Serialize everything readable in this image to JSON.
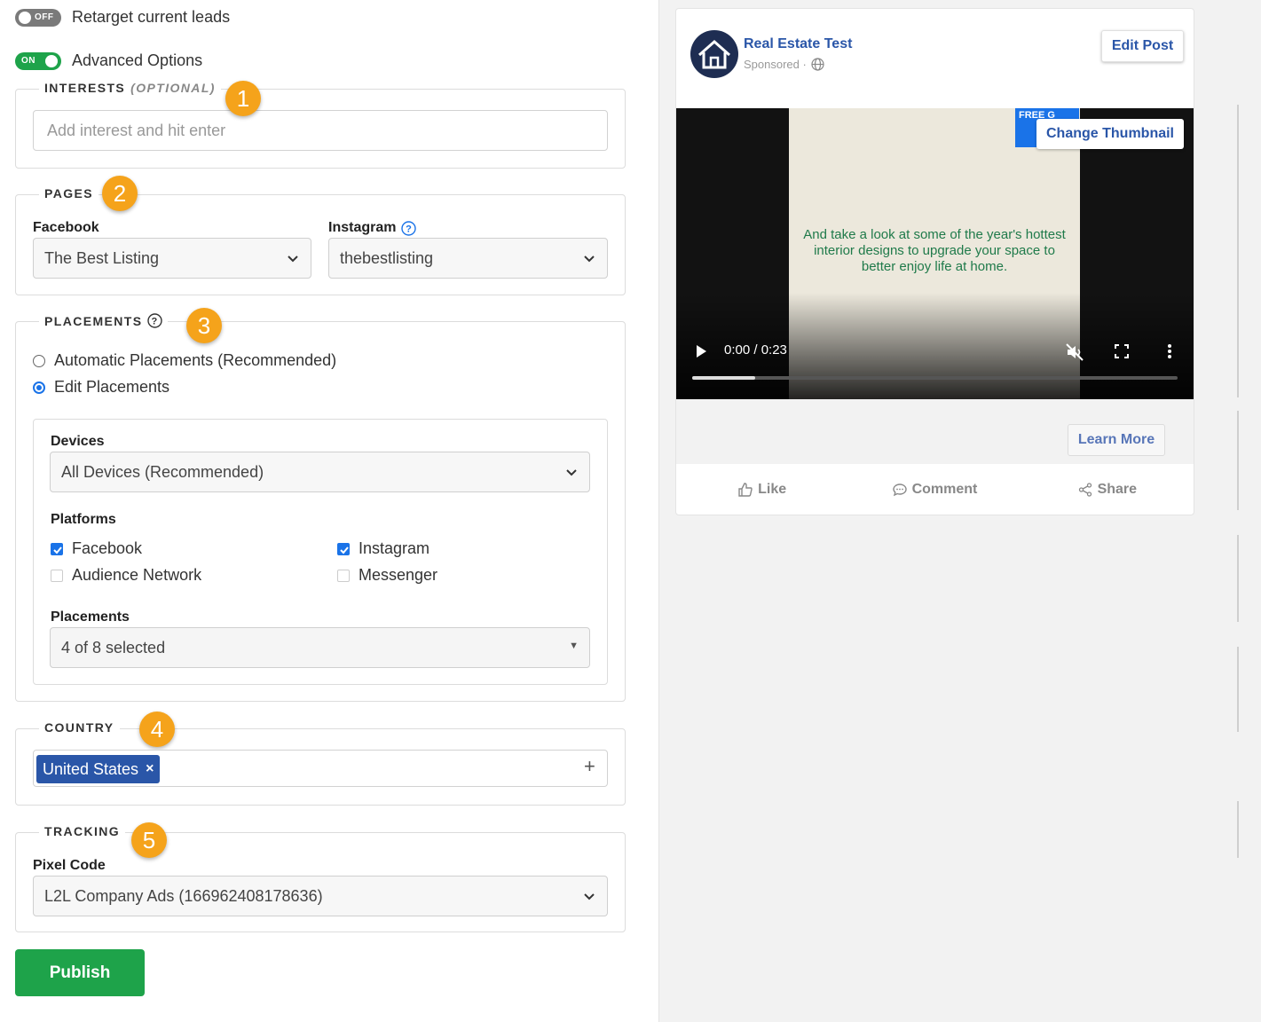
{
  "toggles": {
    "retarget": {
      "state": "OFF",
      "label": "Retarget current leads"
    },
    "advanced": {
      "state": "ON",
      "label": "Advanced Options"
    }
  },
  "interests": {
    "legend": "INTERESTS",
    "optional": "(OPTIONAL)",
    "badge": "1",
    "placeholder": "Add interest and hit enter"
  },
  "pages": {
    "legend": "PAGES",
    "badge": "2",
    "facebook_label": "Facebook",
    "facebook_value": "The Best Listing",
    "instagram_label": "Instagram",
    "instagram_value": "thebestlisting"
  },
  "placements": {
    "legend": "PLACEMENTS",
    "badge": "3",
    "options": [
      {
        "label": "Automatic Placements (Recommended)",
        "selected": false
      },
      {
        "label": "Edit Placements",
        "selected": true
      }
    ],
    "devices_label": "Devices",
    "devices_value": "All Devices (Recommended)",
    "platforms_label": "Platforms",
    "platforms": [
      {
        "label": "Facebook",
        "checked": true
      },
      {
        "label": "Instagram",
        "checked": true
      },
      {
        "label": "Audience Network",
        "checked": false
      },
      {
        "label": "Messenger",
        "checked": false
      }
    ],
    "placements_label": "Placements",
    "placements_value": "4 of 8 selected"
  },
  "country": {
    "legend": "COUNTRY",
    "badge": "4",
    "tags": [
      "United States"
    ],
    "remove_glyph": "×",
    "add_glyph": "+"
  },
  "tracking": {
    "legend": "TRACKING",
    "badge": "5",
    "pixel_label": "Pixel Code",
    "pixel_value": "L2L Company Ads (166962408178636)"
  },
  "publish_label": "Publish",
  "preview": {
    "page_name": "Real Estate Test",
    "sponsored": "Sponsored ·",
    "edit_post": "Edit Post",
    "chip_text": "FREE G",
    "change_thumbnail": "Change Thumbnail",
    "video_caption": "And take a look at some of the year's hottest interior designs to upgrade your space to better enjoy life at home.",
    "video_time": "0:00 / 0:23",
    "video_progress_percent": 13,
    "learn_more": "Learn More",
    "actions": {
      "like": "Like",
      "comment": "Comment",
      "share": "Share"
    }
  },
  "colors": {
    "accent_blue": "#2a56a8",
    "toggle_on": "#1ea34a",
    "badge": "#f5a31b",
    "publish": "#1ea34a"
  }
}
